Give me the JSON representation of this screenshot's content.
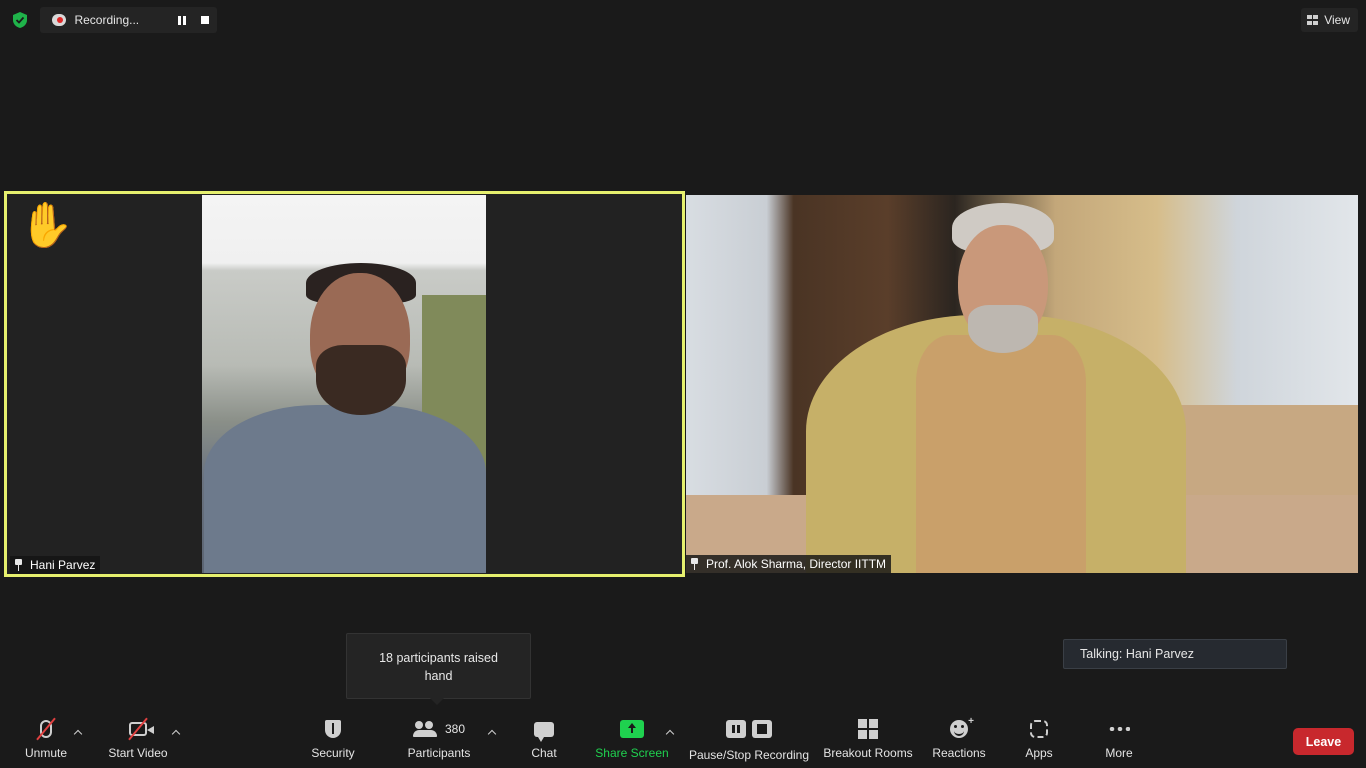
{
  "top_bar": {
    "recording_label": "Recording...",
    "view_label": "View"
  },
  "tiles": [
    {
      "name": "Hani Parvez",
      "raised_hand": "✋",
      "active_speaker_border": "#e6f06e"
    },
    {
      "name": "Prof. Alok Sharma, Director IITTM"
    }
  ],
  "tooltip": {
    "text": "18 participants raised hand"
  },
  "talking": {
    "text": "Talking: Hani Parvez"
  },
  "toolbar": {
    "unmute_label": "Unmute",
    "start_video_label": "Start Video",
    "security_label": "Security",
    "participants_label": "Participants",
    "participants_count": "380",
    "chat_label": "Chat",
    "share_screen_label": "Share Screen",
    "pause_stop_recording_label": "Pause/Stop Recording",
    "breakout_rooms_label": "Breakout Rooms",
    "reactions_label": "Reactions",
    "apps_label": "Apps",
    "more_label": "More",
    "leave_label": "Leave"
  },
  "colors": {
    "share_green": "#1fd14f",
    "leave_red": "#c8282d",
    "muted_red": "#e04040",
    "encryption_green": "#1fb34a"
  }
}
